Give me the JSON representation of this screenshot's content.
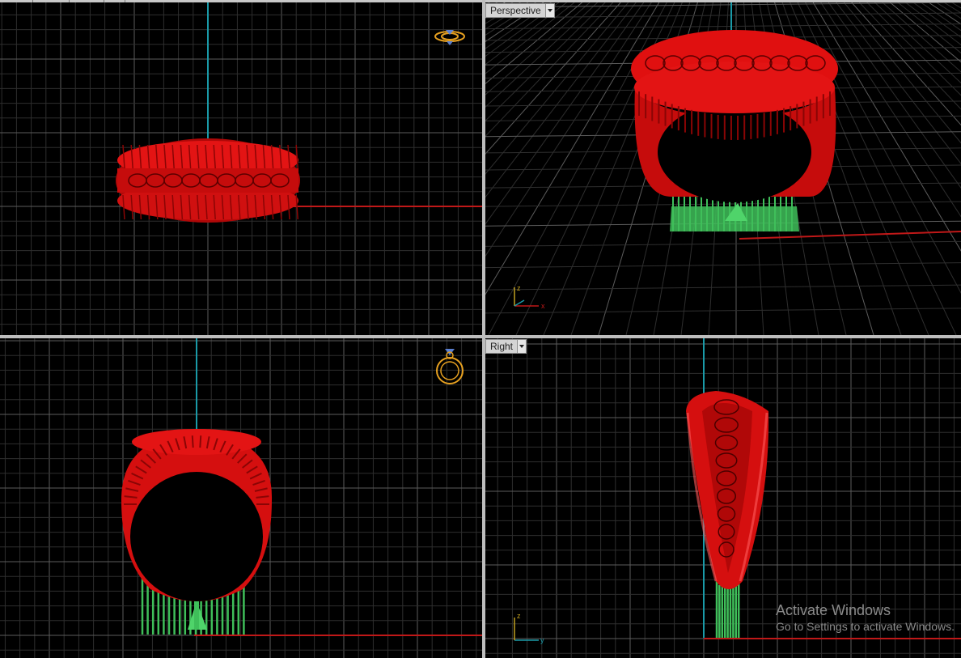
{
  "viewports": {
    "top_left": {
      "label": ""
    },
    "top_right": {
      "label": "Perspective"
    },
    "bottom_left": {
      "label": ""
    },
    "bottom_right": {
      "label": "Right"
    }
  },
  "axes": {
    "x": "x",
    "y": "y",
    "z": "z"
  },
  "watermark": {
    "title": "Activate Windows",
    "subtitle": "Go to Settings to activate Windows."
  },
  "colors": {
    "background": "#000000",
    "grid_minor": "#2e2e2e",
    "grid_major": "#5c5c5c",
    "axis_x": "#c01818",
    "axis_y": "#1a9aa8",
    "model": "#e01010",
    "support": "#3fbf5a",
    "gizmo": "#e6a020"
  }
}
